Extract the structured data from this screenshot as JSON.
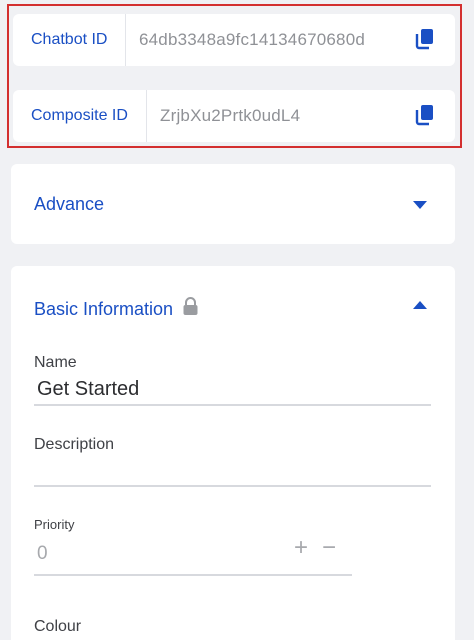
{
  "ids": {
    "chatbot": {
      "label": "Chatbot ID",
      "value": "64db3348a9fc14134670680d"
    },
    "composite": {
      "label": "Composite ID",
      "value": "ZrjbXu2Prtk0udL4"
    },
    "copy_icon": "copy-icon"
  },
  "advance": {
    "title": "Advance",
    "toggle_icon": "chevron-down-icon"
  },
  "basic_info": {
    "title": "Basic Information",
    "lock_icon": "lock-icon",
    "toggle_icon": "chevron-up-icon",
    "name": {
      "label": "Name",
      "value": "Get Started"
    },
    "description": {
      "label": "Description",
      "value": ""
    },
    "priority": {
      "label": "Priority",
      "value": "0",
      "increment": "+",
      "decrement": "−"
    },
    "colour": {
      "label": "Colour"
    }
  },
  "colors": {
    "accent": "#1a4fc4",
    "highlight_border": "#d32f2f",
    "background": "#f0f1f4"
  }
}
